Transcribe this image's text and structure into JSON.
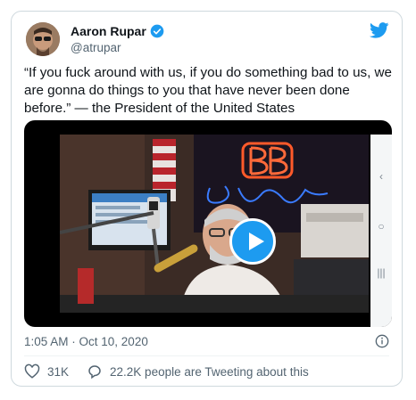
{
  "tweet": {
    "author_name": "Aaron Rupar",
    "author_handle": "@atrupar",
    "text": "“If you fuck around with us, if you do something bad to us, we are gonna do things to you that have never been done before.” — the President of the United States",
    "timestamp": "1:05 AM · Oct 10, 2020",
    "likes": "31K",
    "retweets_text": "22.2K people are Tweeting about this",
    "colors": {
      "accent": "#1d9bf0",
      "text": "#0f1419",
      "muted": "#536471"
    },
    "icons": [
      "twitter-bird-icon",
      "verified-badge-icon",
      "play-icon",
      "info-icon",
      "heart-icon",
      "comment-icon",
      "chevron-left-icon",
      "circle-icon",
      "menu-lines-icon"
    ]
  }
}
